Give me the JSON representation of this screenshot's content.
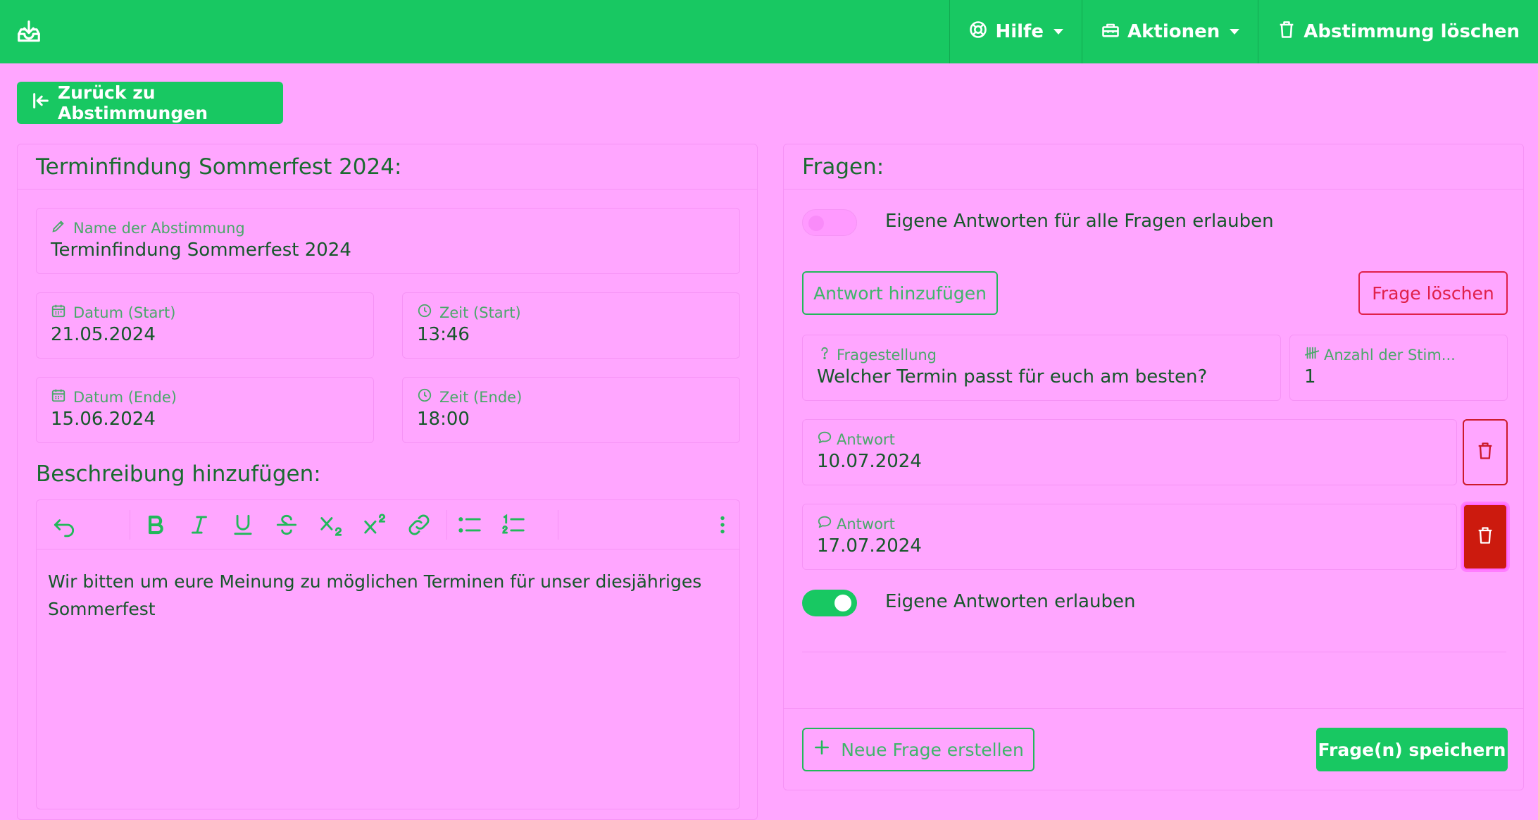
{
  "colors": {
    "navbar": "#18c862",
    "page_background": "#ffa6ff",
    "danger": "#e0204a",
    "danger_filled": "#cc1a0e"
  },
  "navbar": {
    "logo_icon": "download-tray-icon",
    "items": [
      {
        "label": "Hilfe",
        "icon": "lifebuoy-icon",
        "dropdown": true
      },
      {
        "label": "Aktionen",
        "icon": "toolbox-icon",
        "dropdown": true
      },
      {
        "label": "Abstimmung löschen",
        "icon": "trash-icon",
        "dropdown": false
      }
    ]
  },
  "back_button": {
    "label": "Zurück zu Abstimmungen"
  },
  "poll": {
    "header": "Terminfindung Sommerfest 2024:",
    "name": {
      "label": "Name der Abstimmung",
      "value": "Terminfindung Sommerfest 2024"
    },
    "date_start": {
      "label": "Datum (Start)",
      "value": "21.05.2024"
    },
    "time_start": {
      "label": "Zeit (Start)",
      "value": "13:46"
    },
    "date_end": {
      "label": "Datum (Ende)",
      "value": "15.06.2024"
    },
    "time_end": {
      "label": "Zeit (Ende)",
      "value": "18:00"
    },
    "description_title": "Beschreibung hinzufügen:",
    "description_text": "Wir bitten um eure Meinung zu möglichen Terminen für unser diesjähriges Sommerfest"
  },
  "questions": {
    "header": "Fragen:",
    "allow_all_custom": {
      "label": "Eigene Antworten für alle Fragen erlauben",
      "enabled": false
    },
    "add_answer_label": "Antwort hinzufügen",
    "delete_question_label": "Frage löschen",
    "question": {
      "label": "Fragestellung",
      "value": "Welcher Termin passt für euch am besten?"
    },
    "votes": {
      "label": "Anzahl der Stim...",
      "value": "1"
    },
    "answers": [
      {
        "label": "Antwort",
        "value": "10.07.2024"
      },
      {
        "label": "Antwort",
        "value": "17.07.2024"
      }
    ],
    "allow_custom": {
      "label": "Eigene Antworten erlauben",
      "enabled": true
    },
    "new_question_label": "Neue Frage erstellen",
    "save_label": "Frage(n) speichern"
  }
}
